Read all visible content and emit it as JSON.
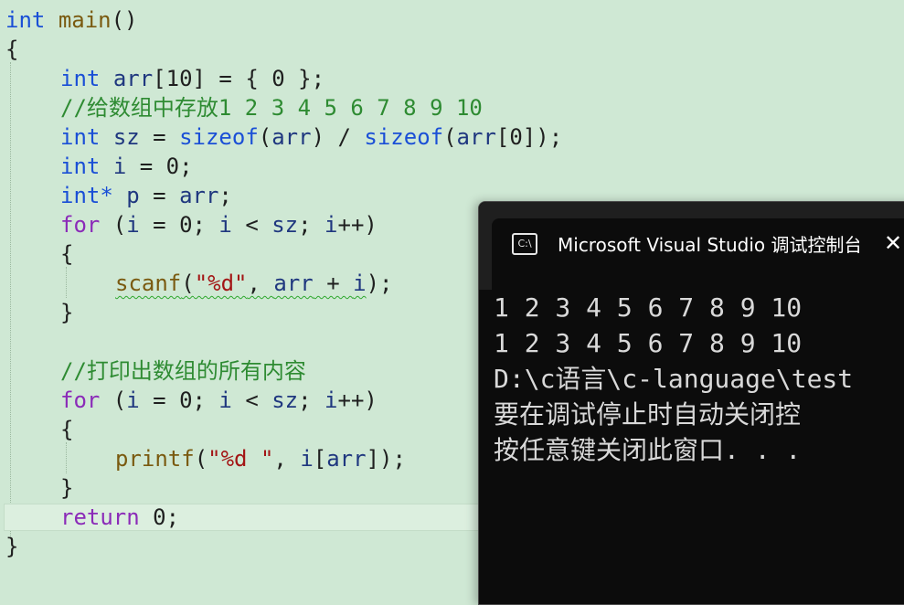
{
  "editor": {
    "lines": [
      {
        "kw": "int",
        "fn": "main",
        "rest": "()"
      },
      "{",
      {
        "type": "int",
        "var": "arr",
        "rest": "[10] = { 0 };"
      },
      "//给数组中存放1 2 3 4 5 6 7 8 9 10",
      {
        "type": "int",
        "var": "sz",
        "eq": " = ",
        "fn1": "sizeof",
        "p1": "(",
        "var2": "arr",
        "p2": ") / ",
        "fn2": "sizeof",
        "p3": "(",
        "var3": "arr",
        "p4": "[0]);"
      },
      {
        "type": "int",
        "var": "i",
        "rest": " = 0;"
      },
      {
        "type": "int*",
        "var": "p",
        "eq": " = ",
        "var2": "arr",
        "rest": ";"
      },
      {
        "kw": "for",
        "p1": " (",
        "v1": "i",
        "p2": " = 0; ",
        "v2": "i",
        "p3": " < ",
        "v3": "sz",
        "p4": "; ",
        "v4": "i",
        "p5": "++)"
      },
      "{",
      {
        "fn": "scanf",
        "p1": "(",
        "str": "\"%d\"",
        "p2": ", ",
        "v1": "arr",
        "p3": " + ",
        "v2": "i",
        "p4": ");"
      },
      "}",
      "//打印出数组的所有内容",
      {
        "kw": "for",
        "p1": " (",
        "v1": "i",
        "p2": " = 0; ",
        "v2": "i",
        "p3": " < ",
        "v3": "sz",
        "p4": "; ",
        "v4": "i",
        "p5": "++)"
      },
      "{",
      {
        "fn": "printf",
        "p1": "(",
        "str": "\"%d \"",
        "p2": ", ",
        "v1": "i",
        "p3": "[",
        "v2": "arr",
        "p4": "]);"
      },
      "}",
      {
        "kw": "return",
        "rest": " 0;"
      },
      "}"
    ]
  },
  "console": {
    "title": "Microsoft Visual Studio 调试控制台",
    "icon": "terminal-icon",
    "icon_text": "C:\\",
    "close_glyph": "✕",
    "output": [
      "1 2 3 4 5 6 7 8 9 10",
      "1 2 3 4 5 6 7 8 9 10",
      "D:\\c语言\\c-language\\test",
      "要在调试停止时自动关闭控",
      "按任意键关闭此窗口. . ."
    ]
  }
}
